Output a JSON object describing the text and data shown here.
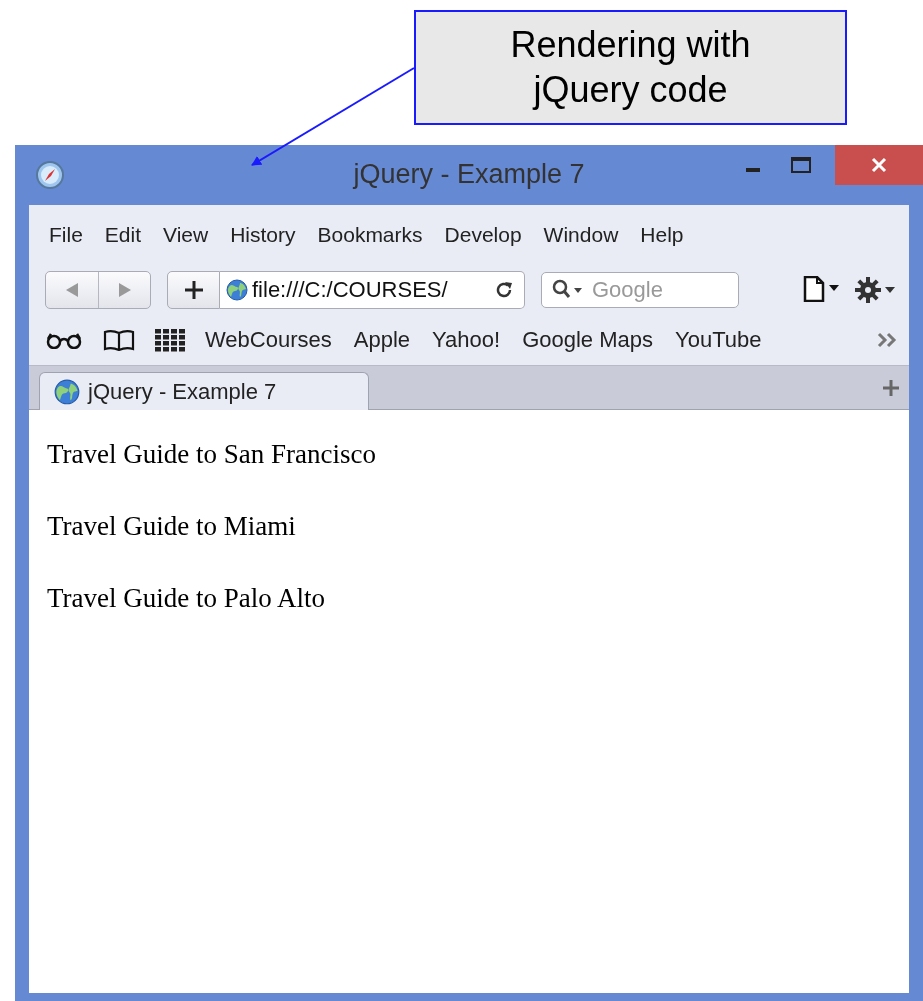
{
  "callout": {
    "text": "Rendering with jQuery code"
  },
  "window": {
    "title": "jQuery - Example 7"
  },
  "menu": [
    "File",
    "Edit",
    "View",
    "History",
    "Bookmarks",
    "Develop",
    "Window",
    "Help"
  ],
  "toolbar": {
    "address": "file:///C:/COURSES/",
    "search_placeholder": "Google"
  },
  "bookmarks": [
    "WebCourses",
    "Apple",
    "Yahoo!",
    "Google Maps",
    "YouTube"
  ],
  "tabs": [
    {
      "label": "jQuery - Example 7",
      "selected": true
    }
  ],
  "content": {
    "paragraphs": [
      "Travel Guide to San Francisco",
      "Travel Guide to Miami",
      "Travel Guide to Palo Alto"
    ]
  }
}
